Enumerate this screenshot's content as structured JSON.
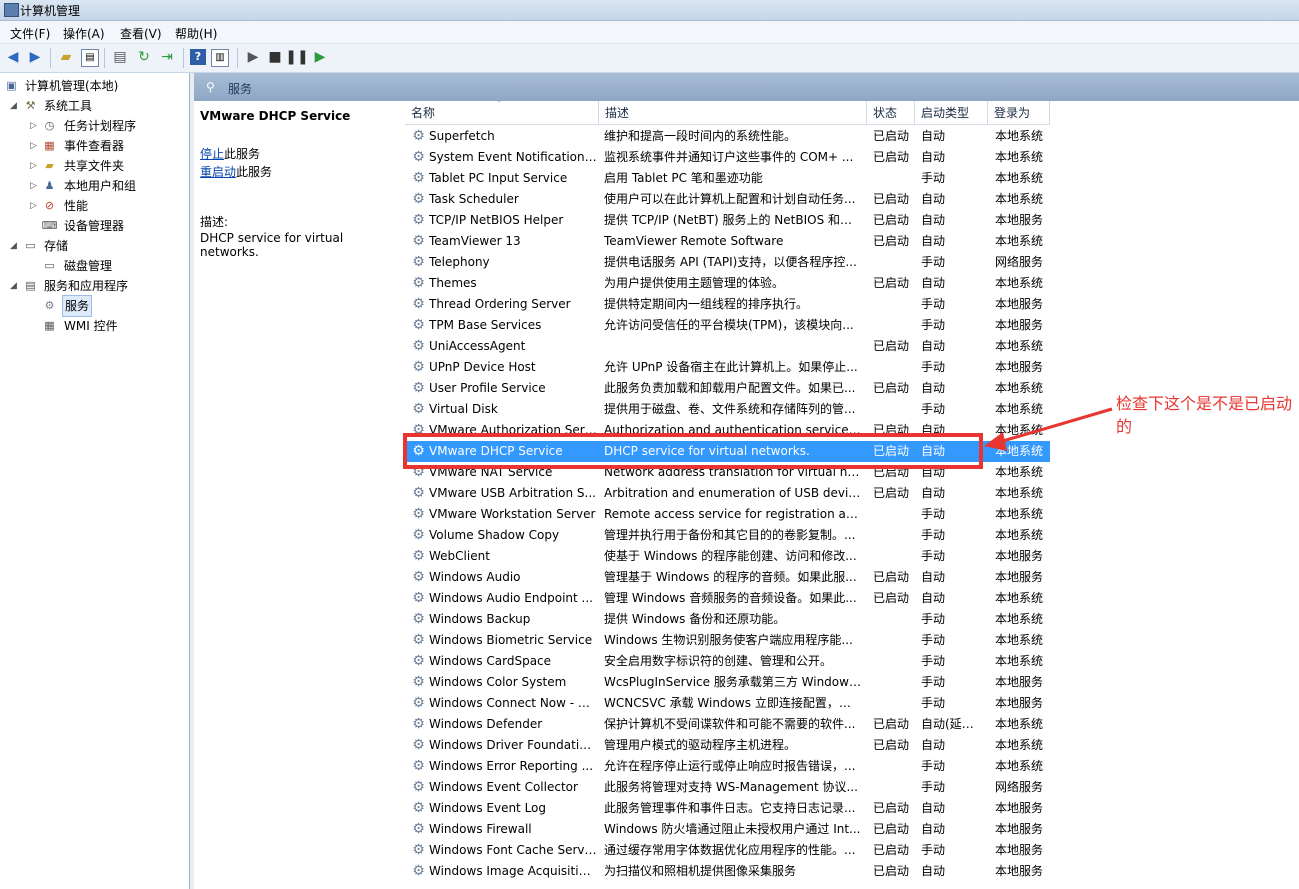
{
  "window": {
    "title": "计算机管理"
  },
  "menu": [
    "文件(F)",
    "操作(A)",
    "查看(V)",
    "帮助(H)"
  ],
  "toolbar_icons": [
    "back-arrow-icon",
    "forward-arrow-icon",
    "up-folder-icon",
    "console-tree-icon",
    "properties-icon",
    "refresh-icon",
    "export-icon",
    "help-icon",
    "show-hide-icon",
    "play-icon",
    "stop-icon",
    "pause-icon",
    "resume-icon"
  ],
  "tree": {
    "root": "计算机管理(本地)",
    "system_tools": "系统工具",
    "task_scheduler": "任务计划程序",
    "event_viewer": "事件查看器",
    "shared_folders": "共享文件夹",
    "local_users": "本地用户和组",
    "performance": "性能",
    "device_manager": "设备管理器",
    "storage": "存储",
    "disk_mgmt": "磁盘管理",
    "services_apps": "服务和应用程序",
    "services": "服务",
    "wmi": "WMI 控件"
  },
  "content": {
    "header": "服务"
  },
  "desc": {
    "service_name": "VMware DHCP Service",
    "stop_link": "停止",
    "stop_suffix": "此服务",
    "restart_link": "重启动",
    "restart_suffix": "此服务",
    "desc_label": "描述:",
    "desc_text": "DHCP service for virtual networks."
  },
  "columns": {
    "name": "名称",
    "desc": "描述",
    "status": "状态",
    "startup": "启动类型",
    "logon": "登录为"
  },
  "services": [
    {
      "name": "Superfetch",
      "desc": "维护和提高一段时间内的系统性能。",
      "status": "已启动",
      "startup": "自动",
      "logon": "本地系统"
    },
    {
      "name": "System Event Notification S...",
      "desc": "监视系统事件并通知订户这些事件的 COM+ ...",
      "status": "已启动",
      "startup": "自动",
      "logon": "本地系统"
    },
    {
      "name": "Tablet PC Input Service",
      "desc": "启用 Tablet PC 笔和墨迹功能",
      "status": "",
      "startup": "手动",
      "logon": "本地系统"
    },
    {
      "name": "Task Scheduler",
      "desc": "使用户可以在此计算机上配置和计划自动任务...",
      "status": "已启动",
      "startup": "自动",
      "logon": "本地系统"
    },
    {
      "name": "TCP/IP NetBIOS Helper",
      "desc": "提供 TCP/IP (NetBT) 服务上的 NetBIOS 和网...",
      "status": "已启动",
      "startup": "自动",
      "logon": "本地服务"
    },
    {
      "name": "TeamViewer 13",
      "desc": "TeamViewer Remote Software",
      "status": "已启动",
      "startup": "自动",
      "logon": "本地系统"
    },
    {
      "name": "Telephony",
      "desc": "提供电话服务 API (TAPI)支持，以便各程序控...",
      "status": "",
      "startup": "手动",
      "logon": "网络服务"
    },
    {
      "name": "Themes",
      "desc": "为用户提供使用主题管理的体验。",
      "status": "已启动",
      "startup": "自动",
      "logon": "本地系统"
    },
    {
      "name": "Thread Ordering Server",
      "desc": "提供特定期间内一组线程的排序执行。",
      "status": "",
      "startup": "手动",
      "logon": "本地服务"
    },
    {
      "name": "TPM Base Services",
      "desc": "允许访问受信任的平台模块(TPM)，该模块向...",
      "status": "",
      "startup": "手动",
      "logon": "本地服务"
    },
    {
      "name": "UniAccessAgent",
      "desc": "",
      "status": "已启动",
      "startup": "自动",
      "logon": "本地系统"
    },
    {
      "name": "UPnP Device Host",
      "desc": "允许 UPnP 设备宿主在此计算机上。如果停止...",
      "status": "",
      "startup": "手动",
      "logon": "本地服务"
    },
    {
      "name": "User Profile Service",
      "desc": "此服务负责加载和卸载用户配置文件。如果已...",
      "status": "已启动",
      "startup": "自动",
      "logon": "本地系统"
    },
    {
      "name": "Virtual Disk",
      "desc": "提供用于磁盘、卷、文件系统和存储阵列的管...",
      "status": "",
      "startup": "手动",
      "logon": "本地系统"
    },
    {
      "name": "VMware Authorization Serv...",
      "desc": "Authorization and authentication service fo...",
      "status": "已启动",
      "startup": "自动",
      "logon": "本地系统"
    },
    {
      "name": "VMware DHCP Service",
      "desc": "DHCP service for virtual networks.",
      "status": "已启动",
      "startup": "自动",
      "logon": "本地系统",
      "selected": true
    },
    {
      "name": "VMware NAT Service",
      "desc": "Network address translation for virtual net...",
      "status": "已启动",
      "startup": "自动",
      "logon": "本地系统"
    },
    {
      "name": "VMware USB Arbitration S...",
      "desc": "Arbitration and enumeration of USB devic...",
      "status": "已启动",
      "startup": "自动",
      "logon": "本地系统"
    },
    {
      "name": "VMware Workstation Server",
      "desc": "Remote access service for registration an...",
      "status": "",
      "startup": "手动",
      "logon": "本地系统"
    },
    {
      "name": "Volume Shadow Copy",
      "desc": "管理并执行用于备份和其它目的的卷影复制。...",
      "status": "",
      "startup": "手动",
      "logon": "本地系统"
    },
    {
      "name": "WebClient",
      "desc": "使基于 Windows 的程序能创建、访问和修改...",
      "status": "",
      "startup": "手动",
      "logon": "本地服务"
    },
    {
      "name": "Windows Audio",
      "desc": "管理基于 Windows 的程序的音频。如果此服...",
      "status": "已启动",
      "startup": "自动",
      "logon": "本地服务"
    },
    {
      "name": "Windows Audio Endpoint ...",
      "desc": "管理 Windows 音频服务的音频设备。如果此...",
      "status": "已启动",
      "startup": "自动",
      "logon": "本地系统"
    },
    {
      "name": "Windows Backup",
      "desc": "提供 Windows 备份和还原功能。",
      "status": "",
      "startup": "手动",
      "logon": "本地系统"
    },
    {
      "name": "Windows Biometric Service",
      "desc": "Windows 生物识别服务使客户端应用程序能...",
      "status": "",
      "startup": "手动",
      "logon": "本地系统"
    },
    {
      "name": "Windows CardSpace",
      "desc": "安全启用数字标识符的创建、管理和公开。",
      "status": "",
      "startup": "手动",
      "logon": "本地系统"
    },
    {
      "name": "Windows Color System",
      "desc": "WcsPlugInService 服务承载第三方 Windows...",
      "status": "",
      "startup": "手动",
      "logon": "本地服务"
    },
    {
      "name": "Windows Connect Now - C...",
      "desc": "WCNCSVC 承载 Windows 立即连接配置，该...",
      "status": "",
      "startup": "手动",
      "logon": "本地服务"
    },
    {
      "name": "Windows Defender",
      "desc": "保护计算机不受间谍软件和可能不需要的软件...",
      "status": "已启动",
      "startup": "自动(延迟...",
      "logon": "本地系统"
    },
    {
      "name": "Windows Driver Foundatio...",
      "desc": "管理用户模式的驱动程序主机进程。",
      "status": "已启动",
      "startup": "自动",
      "logon": "本地系统"
    },
    {
      "name": "Windows Error Reporting ...",
      "desc": "允许在程序停止运行或停止响应时报告错误，...",
      "status": "",
      "startup": "手动",
      "logon": "本地系统"
    },
    {
      "name": "Windows Event Collector",
      "desc": "此服务将管理对支持 WS-Management 协议...",
      "status": "",
      "startup": "手动",
      "logon": "网络服务"
    },
    {
      "name": "Windows Event Log",
      "desc": "此服务管理事件和事件日志。它支持日志记录...",
      "status": "已启动",
      "startup": "自动",
      "logon": "本地服务"
    },
    {
      "name": "Windows Firewall",
      "desc": "Windows 防火墙通过阻止未授权用户通过 Int...",
      "status": "已启动",
      "startup": "自动",
      "logon": "本地服务"
    },
    {
      "name": "Windows Font Cache Service",
      "desc": "通过缓存常用字体数据优化应用程序的性能。...",
      "status": "已启动",
      "startup": "手动",
      "logon": "本地服务"
    },
    {
      "name": "Windows Image Acquisitio...",
      "desc": "为扫描仪和照相机提供图像采集服务",
      "status": "已启动",
      "startup": "自动",
      "logon": "本地服务"
    }
  ],
  "annotation": {
    "text": "检查下这个是不是已启动的",
    "color": "#e8352f"
  },
  "colors": {
    "selection": "#3399ff",
    "link": "#0645ad",
    "header": "#8ea7c4"
  }
}
